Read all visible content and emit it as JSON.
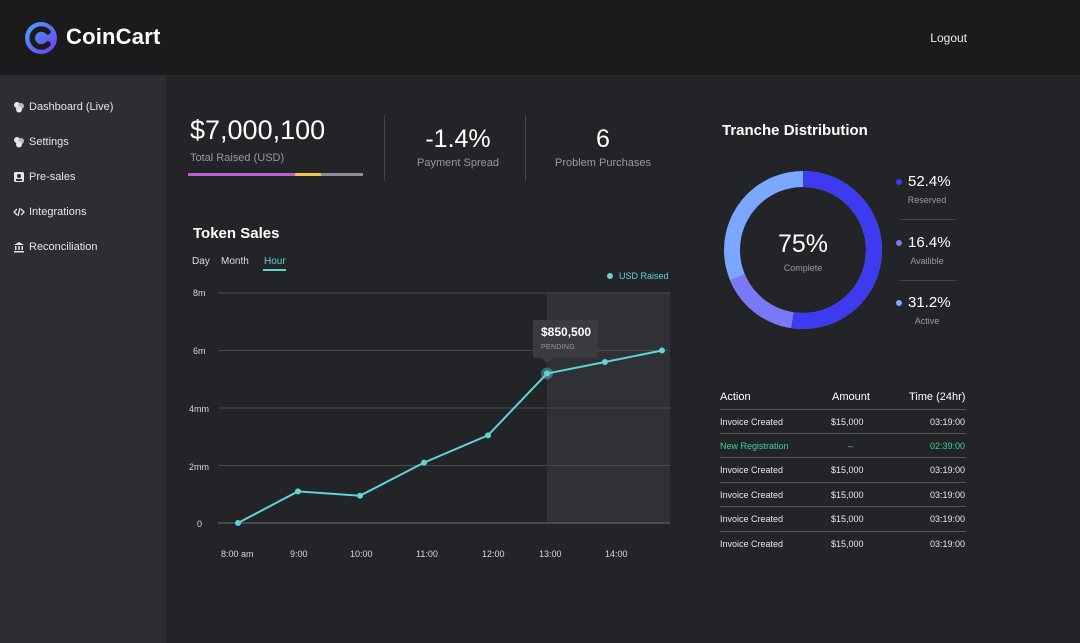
{
  "header": {
    "brand": "CoinCart",
    "logout_label": "Logout"
  },
  "sidebar": {
    "items": [
      {
        "label": "Dashboard (Live)",
        "icon": "dashboard-icon"
      },
      {
        "label": "Settings",
        "icon": "settings-icon"
      },
      {
        "label": "Pre-sales",
        "icon": "presales-icon"
      },
      {
        "label": "Integrations",
        "icon": "code-icon"
      },
      {
        "label": "Reconciliation",
        "icon": "bank-icon"
      }
    ]
  },
  "stats": {
    "total_raised": {
      "value": "$7,000,100",
      "label": "Total Raised (USD)"
    },
    "payment_spread": {
      "value": "-1.4%",
      "label": "Payment Spread"
    },
    "problem_purchases": {
      "value": "6",
      "label": "Problem Purchases"
    },
    "progress_colors": [
      "#c45cd6",
      "#f2c94c",
      "#8e8e92"
    ]
  },
  "token_sales": {
    "title": "Token Sales",
    "tabs": [
      "Day",
      "Month",
      "Hour"
    ],
    "active_tab": "Hour",
    "legend": "USD Raised",
    "tooltip": {
      "value": "$850,500",
      "status": "PENDING"
    }
  },
  "chart_data": {
    "type": "line",
    "series": [
      {
        "name": "USD Raised",
        "color": "#5fd3d6"
      }
    ],
    "x": [
      "8:00 am",
      "9:00",
      "10:00",
      "11:00",
      "12:00",
      "13:00",
      "14:00",
      "15:00"
    ],
    "y": [
      0,
      1.1,
      0.95,
      2.1,
      3.05,
      5.2,
      5.6,
      6.0
    ],
    "yticks": [
      "8m",
      "6m",
      "4mm",
      "2mm",
      "0"
    ],
    "xticks": [
      "8:00 am",
      "9:00",
      "10:00",
      "11:00",
      "12:00",
      "13:00",
      "14:00"
    ],
    "ylim": [
      0,
      8
    ],
    "grid": true,
    "highlight_from_x": "13:00"
  },
  "tranche": {
    "title": "Tranche Distribution",
    "center_value": "75%",
    "center_label": "Complete",
    "items": [
      {
        "value": "52.4%",
        "label": "Reserved",
        "color": "#3d3af0"
      },
      {
        "value": "16.4%",
        "label": "Availible",
        "color": "#7b78f5"
      },
      {
        "value": "31.2%",
        "label": "Active",
        "color": "#7aa7ff"
      }
    ]
  },
  "table": {
    "headers": [
      "Action",
      "Amount",
      "Time (24hr)"
    ],
    "rows": [
      {
        "action": "Invoice Created",
        "amount": "$15,000",
        "time": "03:19:00",
        "highlight": false
      },
      {
        "action": "New Registration",
        "amount": "–",
        "time": "02:39:00",
        "highlight": true
      },
      {
        "action": "Invoice Created",
        "amount": "$15,000",
        "time": "03:19:00",
        "highlight": false
      },
      {
        "action": "Invoice Created",
        "amount": "$15,000",
        "time": "03:19:00",
        "highlight": false
      },
      {
        "action": "Invoice Created",
        "amount": "$15,000",
        "time": "03:19:00",
        "highlight": false
      },
      {
        "action": "Invoice Created",
        "amount": "$15,000",
        "time": "03:19:00",
        "highlight": false
      }
    ]
  }
}
